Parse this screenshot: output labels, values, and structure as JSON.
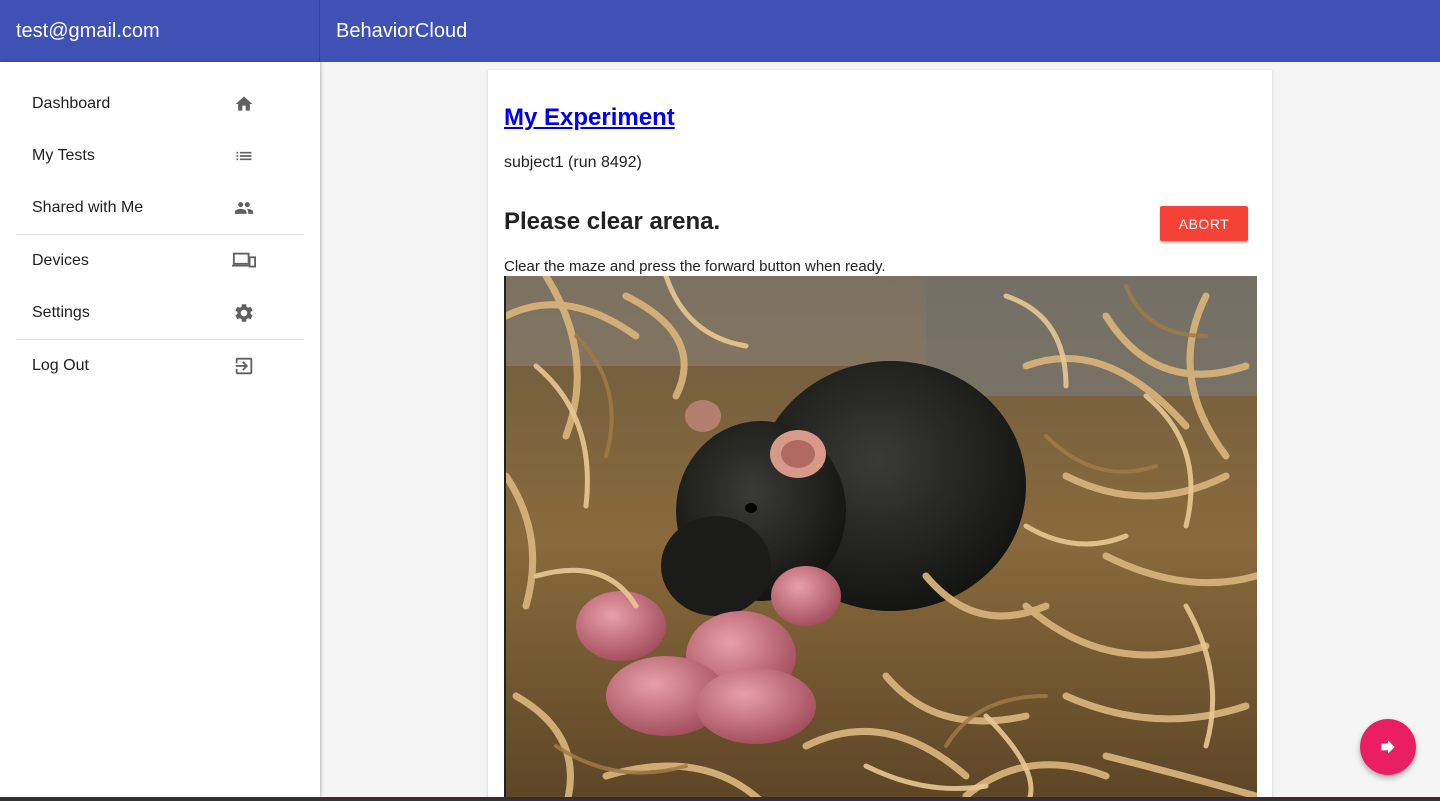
{
  "header": {
    "user_email": "test@gmail.com",
    "app_title": "BehaviorCloud"
  },
  "sidebar": {
    "items": [
      {
        "label": "Dashboard",
        "icon": "home-icon"
      },
      {
        "label": "My Tests",
        "icon": "list-icon"
      },
      {
        "label": "Shared with Me",
        "icon": "people-icon"
      },
      {
        "label": "Devices",
        "icon": "devices-icon"
      },
      {
        "label": "Settings",
        "icon": "gear-icon"
      },
      {
        "label": "Log Out",
        "icon": "exit-icon"
      }
    ]
  },
  "main": {
    "experiment_title": "My Experiment",
    "subject_line": "subject1 (run 8492)",
    "step_title": "Please clear arena.",
    "abort_label": "ABORT",
    "instructions": "Clear the maze and press the forward button when ready.",
    "photo_description_icon": "mouse-nest-photo",
    "forward_icon": "forward-arrow-icon"
  },
  "colors": {
    "primary": "#3f51b5",
    "abort": "#f44336",
    "fab": "#e91e63",
    "link": "#0000ee"
  }
}
